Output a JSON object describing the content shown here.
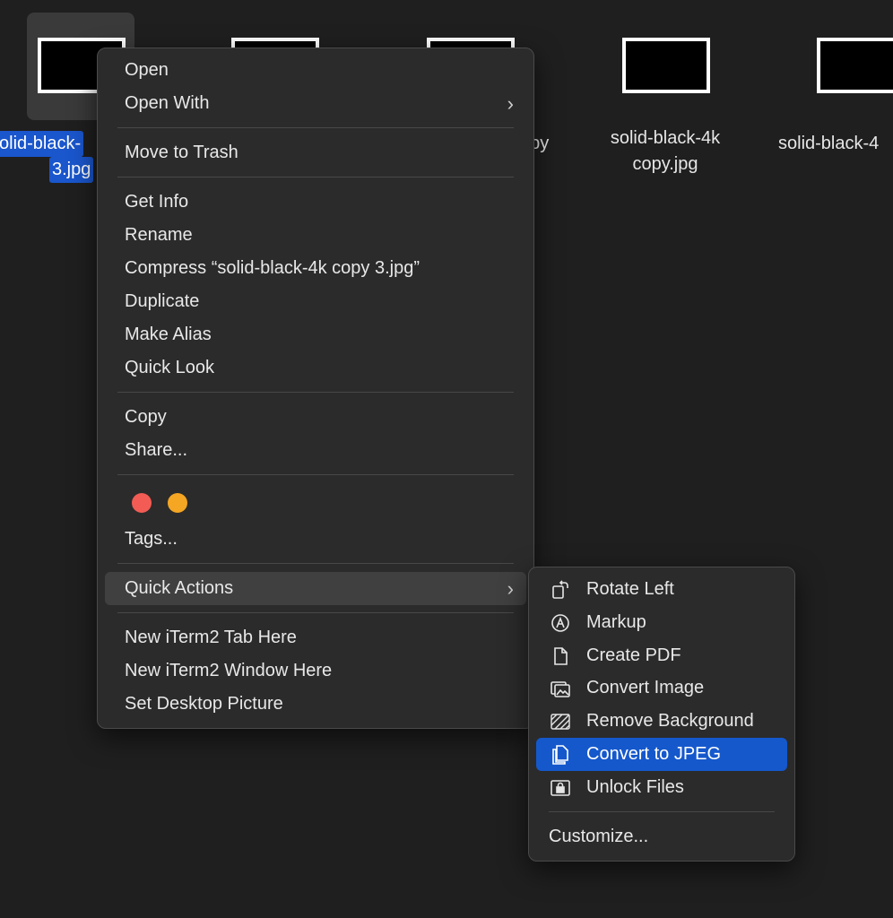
{
  "desktop": {
    "files": [
      {
        "line1": "olid-black-",
        "line2": "3.jpg",
        "selected": true
      },
      {
        "line1": "",
        "line2": ""
      },
      {
        "line1": "opy",
        "line2": ""
      },
      {
        "line1": "solid-black-4k",
        "line2": "copy.jpg"
      },
      {
        "line1": "solid-black-4",
        "line2": ""
      }
    ]
  },
  "context_menu": {
    "open": "Open",
    "open_with": "Open With",
    "move_to_trash": "Move to Trash",
    "get_info": "Get Info",
    "rename": "Rename",
    "compress": "Compress “solid-black-4k copy 3.jpg”",
    "duplicate": "Duplicate",
    "make_alias": "Make Alias",
    "quick_look": "Quick Look",
    "copy": "Copy",
    "share": "Share...",
    "tag_colors": [
      "#f25c54",
      "#f5a623"
    ],
    "tags": "Tags...",
    "quick_actions": "Quick Actions",
    "new_iterm_tab": "New iTerm2 Tab Here",
    "new_iterm_window": "New iTerm2 Window Here",
    "set_desktop_picture": "Set Desktop Picture",
    "chevron": "›"
  },
  "quick_actions_menu": {
    "items": [
      {
        "label": "Rotate Left",
        "icon": "rotate-left-icon"
      },
      {
        "label": "Markup",
        "icon": "markup-icon"
      },
      {
        "label": "Create PDF",
        "icon": "document-icon"
      },
      {
        "label": "Convert Image",
        "icon": "images-icon"
      },
      {
        "label": "Remove Background",
        "icon": "remove-background-icon"
      },
      {
        "label": "Convert to JPEG",
        "icon": "documents-icon",
        "active": true
      },
      {
        "label": "Unlock Files",
        "icon": "lock-icon"
      }
    ],
    "customize": "Customize..."
  },
  "colors": {
    "background": "#1f1f1f",
    "menu": "#2b2b2b",
    "selection": "#1558cc",
    "hover": "#404040"
  }
}
